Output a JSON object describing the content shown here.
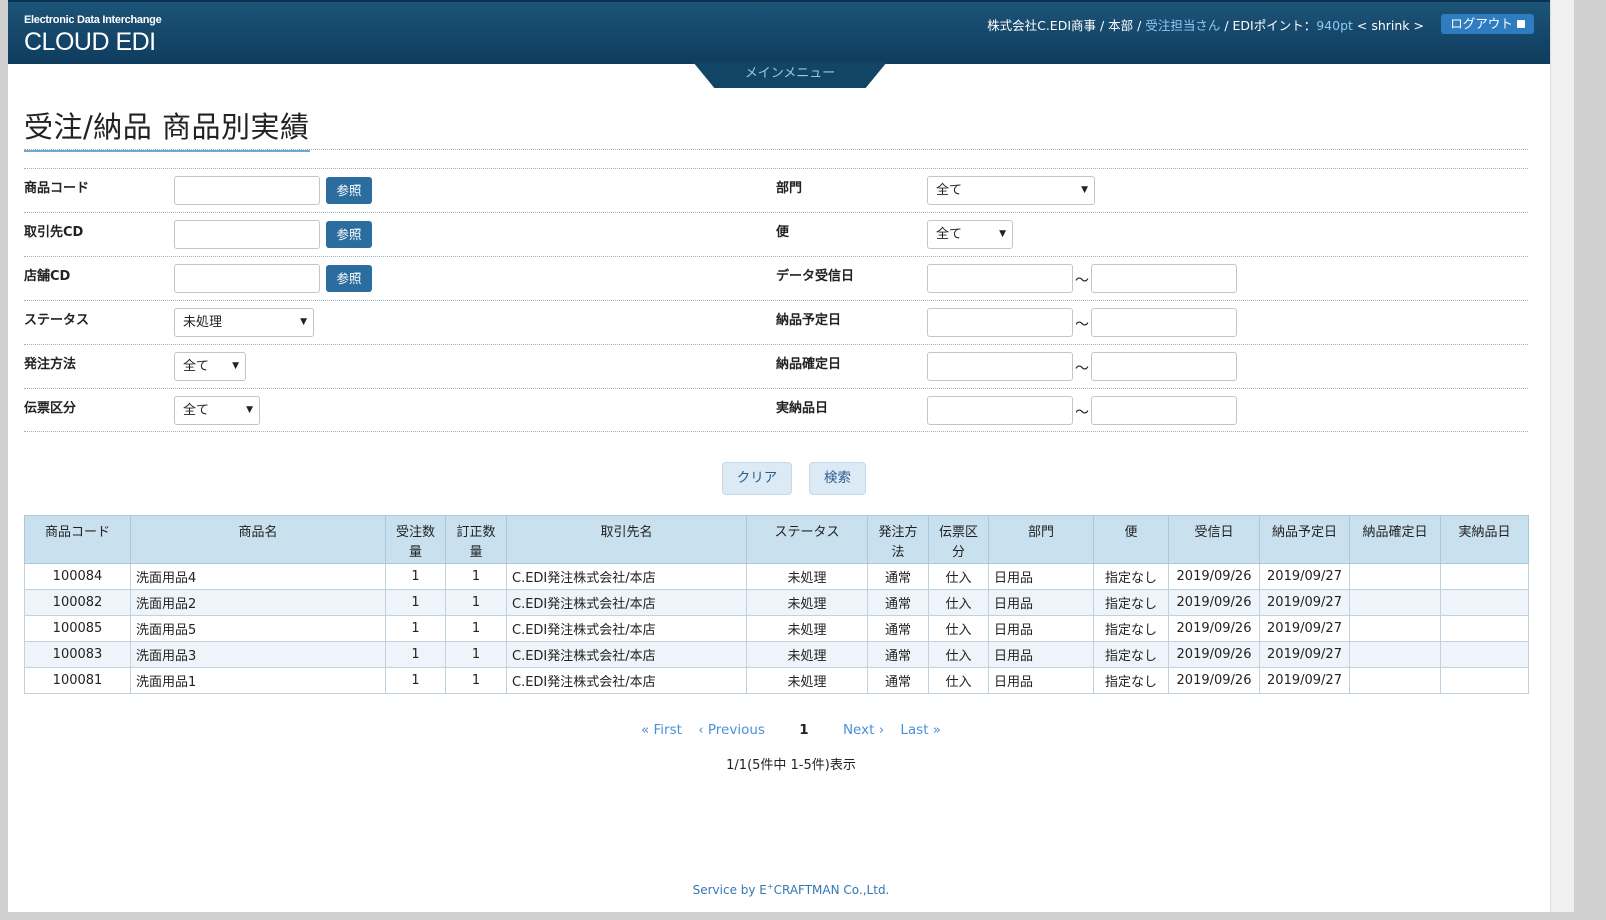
{
  "header": {
    "brand_sub": "Electronic Data Interchange",
    "brand_main": "CLOUD EDI",
    "company": "株式会社C.EDI商事 / 本部 / ",
    "user_link": "受注担当さん",
    "points_prefix": " / EDIポイント：",
    "points": "940pt",
    "shrink_label": " < shrink >",
    "logout_label": "ログアウト"
  },
  "menu_tab": {
    "label": "メインメニュー"
  },
  "page_title": "受注/納品 商品別実績",
  "form": {
    "product_code_label": "商品コード",
    "partner_cd_label": "取引先CD",
    "store_cd_label": "店舗CD",
    "status_label": "ステータス",
    "order_method_label": "発注方法",
    "slip_type_label": "伝票区分",
    "ref_button": "参照",
    "status_value": "未処理",
    "order_method_value": "全て",
    "slip_type_value": "全て",
    "department_label": "部門",
    "department_value": "全て",
    "delivery_label": "便",
    "delivery_value": "全て",
    "received_date_label": "データ受信日",
    "planned_date_label": "納品予定日",
    "confirmed_date_label": "納品確定日",
    "actual_date_label": "実納品日",
    "tilde": "～"
  },
  "actions": {
    "clear": "クリア",
    "search": "検索"
  },
  "table": {
    "headers": {
      "code": "商品コード",
      "name": "商品名",
      "order_qty_1": "受注数",
      "order_qty_2": "量",
      "corr_qty_1": "訂正数",
      "corr_qty_2": "量",
      "partner": "取引先名",
      "status": "ステータス",
      "method_1": "発注方",
      "method_2": "法",
      "slip_1": "伝票区",
      "slip_2": "分",
      "dept": "部門",
      "delivery": "便",
      "received": "受信日",
      "planned": "納品予定日",
      "confirmed": "納品確定日",
      "actual": "実納品日"
    },
    "rows": [
      {
        "code": "100084",
        "name": "洗面用品4",
        "order_qty": "1",
        "corr_qty": "1",
        "partner": "C.EDI発注株式会社/本店",
        "status": "未処理",
        "method": "通常",
        "slip": "仕入",
        "dept": "日用品",
        "delivery": "指定なし",
        "received": "2019/09/26",
        "planned": "2019/09/27",
        "confirmed": "",
        "actual": ""
      },
      {
        "code": "100082",
        "name": "洗面用品2",
        "order_qty": "1",
        "corr_qty": "1",
        "partner": "C.EDI発注株式会社/本店",
        "status": "未処理",
        "method": "通常",
        "slip": "仕入",
        "dept": "日用品",
        "delivery": "指定なし",
        "received": "2019/09/26",
        "planned": "2019/09/27",
        "confirmed": "",
        "actual": ""
      },
      {
        "code": "100085",
        "name": "洗面用品5",
        "order_qty": "1",
        "corr_qty": "1",
        "partner": "C.EDI発注株式会社/本店",
        "status": "未処理",
        "method": "通常",
        "slip": "仕入",
        "dept": "日用品",
        "delivery": "指定なし",
        "received": "2019/09/26",
        "planned": "2019/09/27",
        "confirmed": "",
        "actual": ""
      },
      {
        "code": "100083",
        "name": "洗面用品3",
        "order_qty": "1",
        "corr_qty": "1",
        "partner": "C.EDI発注株式会社/本店",
        "status": "未処理",
        "method": "通常",
        "slip": "仕入",
        "dept": "日用品",
        "delivery": "指定なし",
        "received": "2019/09/26",
        "planned": "2019/09/27",
        "confirmed": "",
        "actual": ""
      },
      {
        "code": "100081",
        "name": "洗面用品1",
        "order_qty": "1",
        "corr_qty": "1",
        "partner": "C.EDI発注株式会社/本店",
        "status": "未処理",
        "method": "通常",
        "slip": "仕入",
        "dept": "日用品",
        "delivery": "指定なし",
        "received": "2019/09/26",
        "planned": "2019/09/27",
        "confirmed": "",
        "actual": ""
      }
    ]
  },
  "pager": {
    "first": "« First",
    "previous": "‹ Previous",
    "current": "1",
    "next": "Next ›",
    "last": "Last »",
    "summary": "1/1(5件中 1-5件)表示"
  },
  "footer": {
    "prefix": "Service by E",
    "sup": "+",
    "suffix": "CRAFTMAN Co.,Ltd."
  }
}
